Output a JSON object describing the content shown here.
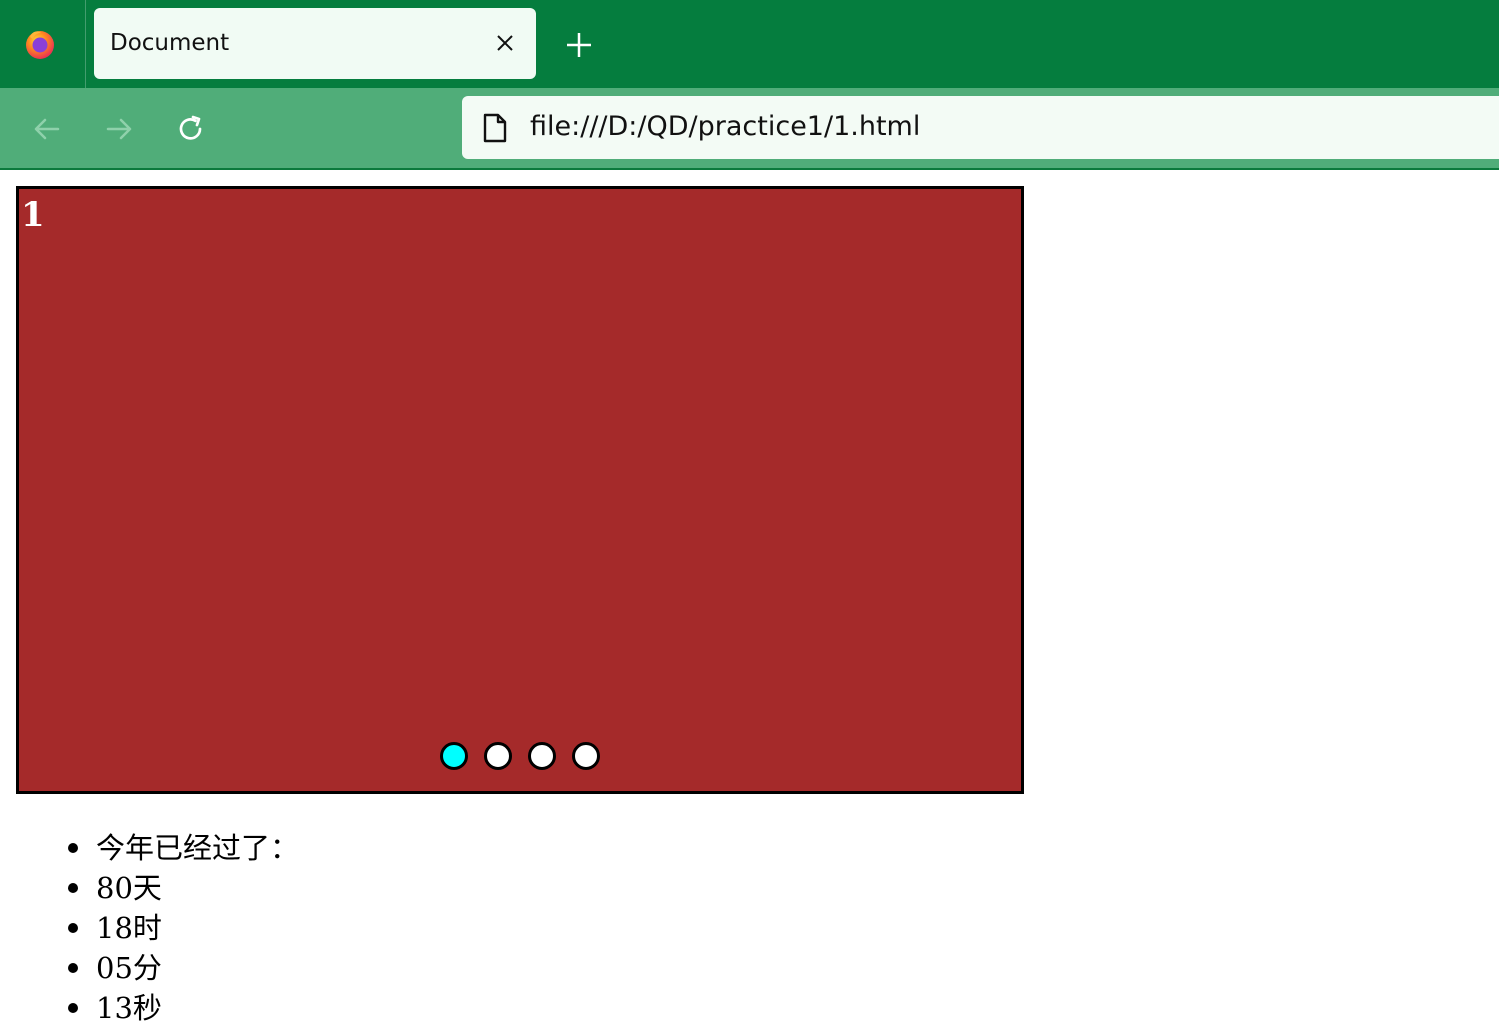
{
  "browser": {
    "tab": {
      "title": "Document"
    },
    "url": "file:///D:/QD/practice1/1.html",
    "colors": {
      "tabstrip": "#057d3e",
      "navbar": "#50ad79",
      "tab": "#f1fbf4"
    }
  },
  "slider": {
    "current_slide": "1",
    "background": "#a52a2a",
    "dots": [
      {
        "active": true,
        "color": "#00ffff"
      },
      {
        "active": false,
        "color": "#ffffff"
      },
      {
        "active": false,
        "color": "#ffffff"
      },
      {
        "active": false,
        "color": "#ffffff"
      }
    ]
  },
  "countdown": {
    "items": [
      "今年已经过了：",
      "80天",
      "18时",
      "05分",
      "13秒"
    ]
  }
}
